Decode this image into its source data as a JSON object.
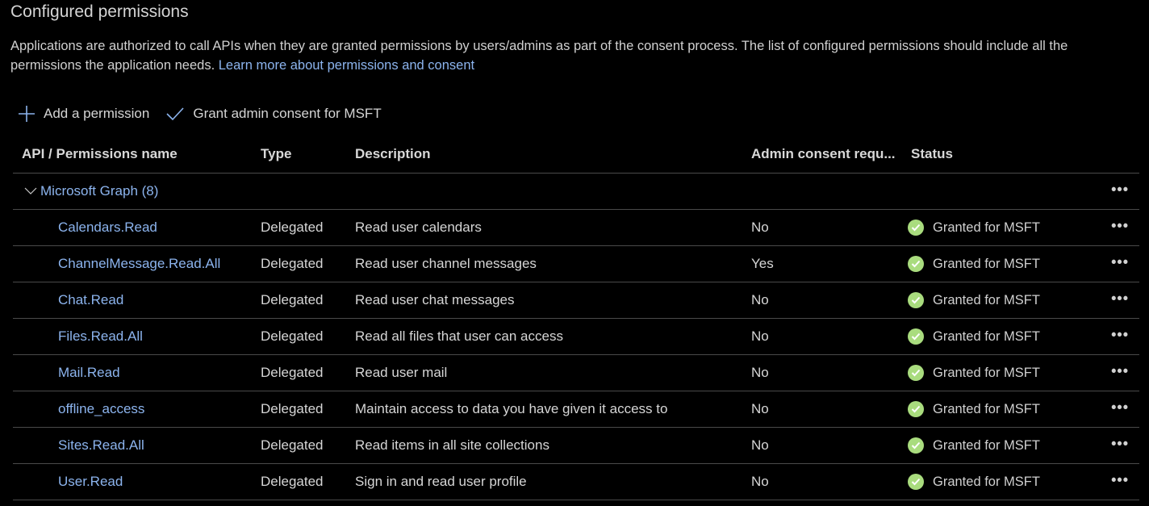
{
  "page": {
    "title": "Configured permissions",
    "description": "Applications are authorized to call APIs when they are granted permissions by users/admins as part of the consent process. The list of configured permissions should include all the permissions the application needs.",
    "learn_more_link": "Learn more about permissions and consent"
  },
  "toolbar": {
    "add_permission_label": "Add a permission",
    "add_permission_icon": "plus-icon",
    "grant_consent_label": "Grant admin consent for MSFT",
    "grant_consent_icon": "checkmark-icon"
  },
  "table": {
    "headers": {
      "name": "API / Permissions name",
      "type": "Type",
      "description": "Description",
      "admin_consent": "Admin consent requ...",
      "status": "Status"
    },
    "group": {
      "label": "Microsoft Graph (8)",
      "expanded": true,
      "more_icon": "ellipsis-icon"
    },
    "rows": [
      {
        "name": "Calendars.Read",
        "type": "Delegated",
        "description": "Read user calendars",
        "admin_consent": "No",
        "status": "Granted for MSFT"
      },
      {
        "name": "ChannelMessage.Read.All",
        "type": "Delegated",
        "description": "Read user channel messages",
        "admin_consent": "Yes",
        "status": "Granted for MSFT"
      },
      {
        "name": "Chat.Read",
        "type": "Delegated",
        "description": "Read user chat messages",
        "admin_consent": "No",
        "status": "Granted for MSFT"
      },
      {
        "name": "Files.Read.All",
        "type": "Delegated",
        "description": "Read all files that user can access",
        "admin_consent": "No",
        "status": "Granted for MSFT"
      },
      {
        "name": "Mail.Read",
        "type": "Delegated",
        "description": "Read user mail",
        "admin_consent": "No",
        "status": "Granted for MSFT"
      },
      {
        "name": "offline_access",
        "type": "Delegated",
        "description": "Maintain access to data you have given it access to",
        "admin_consent": "No",
        "status": "Granted for MSFT"
      },
      {
        "name": "Sites.Read.All",
        "type": "Delegated",
        "description": "Read items in all site collections",
        "admin_consent": "No",
        "status": "Granted for MSFT"
      },
      {
        "name": "User.Read",
        "type": "Delegated",
        "description": "Sign in and read user profile",
        "admin_consent": "No",
        "status": "Granted for MSFT"
      }
    ]
  },
  "colors": {
    "background": "#000000",
    "link": "#8cb4ee",
    "granted_status": "#a9dc7e",
    "divider": "#4a4a4a"
  }
}
